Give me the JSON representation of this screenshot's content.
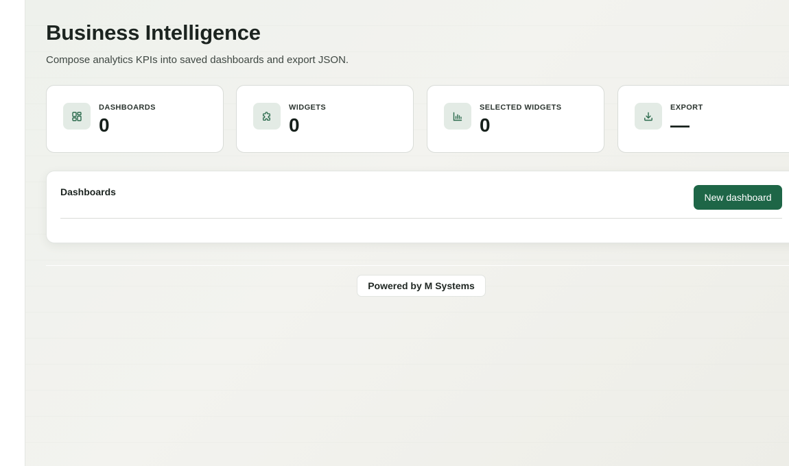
{
  "header": {
    "title": "Business Intelligence",
    "subtitle": "Compose analytics KPIs into saved dashboards and export JSON."
  },
  "stats": [
    {
      "label": "DASHBOARDS",
      "value": "0",
      "icon": "dashboard-grid-icon"
    },
    {
      "label": "WIDGETS",
      "value": "0",
      "icon": "puzzle-icon"
    },
    {
      "label": "SELECTED WIDGETS",
      "value": "0",
      "icon": "bar-chart-icon"
    },
    {
      "label": "EXPORT",
      "value": "—",
      "icon": "download-icon"
    }
  ],
  "dashboards_panel": {
    "title": "Dashboards",
    "new_button_label": "New dashboard"
  },
  "footer": {
    "powered_by": "Powered by M Systems"
  },
  "colors": {
    "accent": "#1e6647",
    "icon_bg": "#e3ebe5",
    "icon_stroke": "#2a6a4c"
  }
}
